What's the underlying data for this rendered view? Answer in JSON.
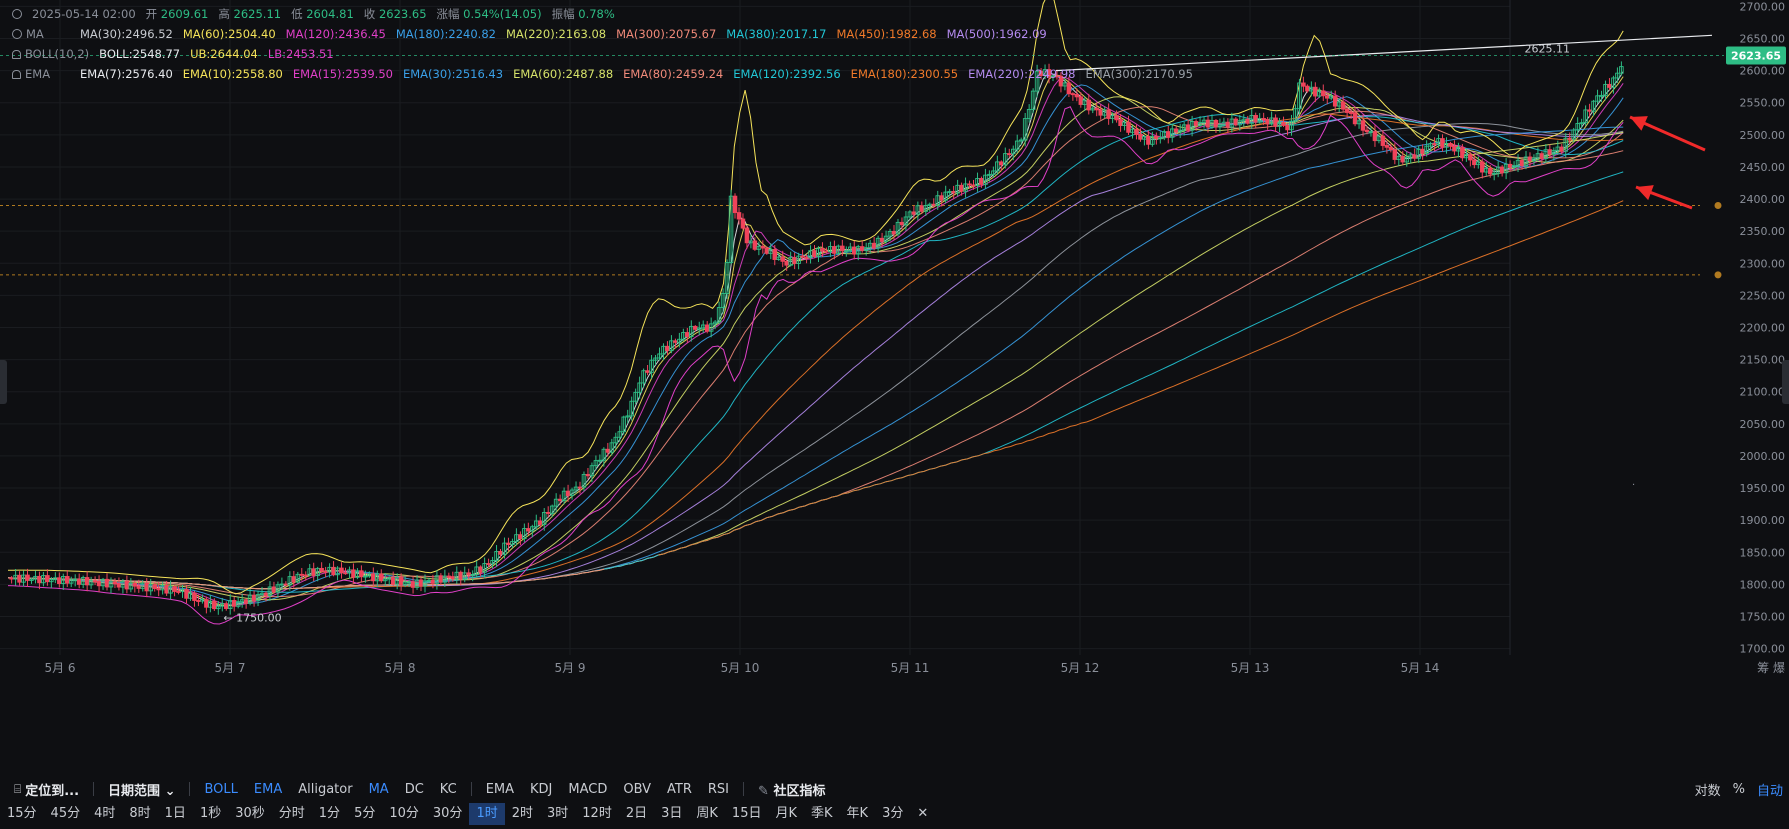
{
  "header": {
    "date": "2025-05-14 02:00",
    "open_label": "开",
    "open": "2609.61",
    "high_label": "高",
    "high": "2625.11",
    "low_label": "低",
    "low": "2604.81",
    "close_label": "收",
    "close": "2623.65",
    "chg_label": "涨幅",
    "chg": "0.54%(14.05)",
    "amp_label": "振幅",
    "amp": "0.78%"
  },
  "ma_row": {
    "tag": "MA",
    "items": [
      {
        "text": "MA(30):2496.52",
        "color": "#c9ccd2"
      },
      {
        "text": "MA(60):2504.40",
        "color": "#f5e35a"
      },
      {
        "text": "MA(120):2436.45",
        "color": "#e040c8"
      },
      {
        "text": "MA(180):2240.82",
        "color": "#3aa0e8"
      },
      {
        "text": "MA(220):2163.08",
        "color": "#d6e26a"
      },
      {
        "text": "MA(300):2075.67",
        "color": "#f08a7a"
      },
      {
        "text": "MA(380):2017.17",
        "color": "#22c7d6"
      },
      {
        "text": "MA(450):1982.68",
        "color": "#f07a2a"
      },
      {
        "text": "MA(500):1962.09",
        "color": "#b58cf0"
      }
    ]
  },
  "boll_row": {
    "tag": "BOLL(10,2)",
    "items": [
      {
        "text": "BOLL:2548.77",
        "color": "#e8eaee"
      },
      {
        "text": "UB:2644.04",
        "color": "#f5e35a"
      },
      {
        "text": "LB:2453.51",
        "color": "#e040c8"
      }
    ]
  },
  "ema_row": {
    "tag": "EMA",
    "items": [
      {
        "text": "EMA(7):2576.40",
        "color": "#e8eaee"
      },
      {
        "text": "EMA(10):2558.80",
        "color": "#f5e35a"
      },
      {
        "text": "EMA(15):2539.50",
        "color": "#e040c8"
      },
      {
        "text": "EMA(30):2516.43",
        "color": "#3aa0e8"
      },
      {
        "text": "EMA(60):2487.88",
        "color": "#d6e26a"
      },
      {
        "text": "EMA(80):2459.24",
        "color": "#f08a7a"
      },
      {
        "text": "EMA(120):2392.56",
        "color": "#22c7d6"
      },
      {
        "text": "EMA(180):2300.55",
        "color": "#f07a2a"
      },
      {
        "text": "EMA(220):2249.98",
        "color": "#b58cf0"
      },
      {
        "text": "EMA(300):2170.95",
        "color": "#9aa0a8"
      }
    ]
  },
  "price_label": "2623.65",
  "high_marker": "2625.11",
  "low_marker": "← 1750.00",
  "axis_corner": "筹 爆",
  "colors": {
    "up": "#2ebd85",
    "down": "#f0435a",
    "price_tag": "#2ebd85",
    "grid": "#1a1c20",
    "dash": "#b07a20"
  },
  "toolbar": {
    "locate": "定位到...",
    "daterange": "日期范围",
    "indicators_main": [
      "BOLL",
      "EMA",
      "Alligator",
      "MA",
      "DC",
      "KC"
    ],
    "indicators_sub": [
      "EMA",
      "KDJ",
      "MACD",
      "OBV",
      "ATR",
      "RSI"
    ],
    "community": "社区指标",
    "right": [
      "对数",
      "%",
      "自动"
    ]
  },
  "timeframes": [
    "15分",
    "45分",
    "4时",
    "8时",
    "1日",
    "1秒",
    "30秒",
    "分时",
    "1分",
    "5分",
    "10分",
    "30分",
    "1时",
    "2时",
    "3时",
    "12时",
    "2日",
    "3日",
    "周K",
    "15日",
    "月K",
    "季K",
    "年K",
    "3分"
  ],
  "active_timeframe": "1时",
  "chart_data": {
    "type": "candlestick",
    "x_labels": [
      "5月 6",
      "5月 7",
      "5月 8",
      "5月 9",
      "5月 10",
      "5月 11",
      "5月 12",
      "5月 13",
      "5月 14"
    ],
    "y_ticks": [
      1700,
      1750,
      1800,
      1850,
      1900,
      1950,
      2000,
      2050,
      2100,
      2150,
      2200,
      2250,
      2300,
      2350,
      2400,
      2450,
      2500,
      2550,
      2600,
      2650,
      2700
    ],
    "ylim": [
      1690,
      2710
    ],
    "last_price": 2623.65,
    "session_high": 2625.11,
    "session_low": 1750.0,
    "horizontal_levels": [
      2390,
      2282
    ],
    "price_path": [
      [
        0,
        1810
      ],
      [
        20,
        1808
      ],
      [
        40,
        1805
      ],
      [
        60,
        1800
      ],
      [
        80,
        1795
      ],
      [
        95,
        1790
      ],
      [
        105,
        1775
      ],
      [
        115,
        1765
      ],
      [
        125,
        1770
      ],
      [
        135,
        1778
      ],
      [
        145,
        1790
      ],
      [
        155,
        1805
      ],
      [
        165,
        1818
      ],
      [
        175,
        1822
      ],
      [
        185,
        1820
      ],
      [
        195,
        1815
      ],
      [
        205,
        1810
      ],
      [
        215,
        1805
      ],
      [
        225,
        1800
      ],
      [
        235,
        1806
      ],
      [
        245,
        1812
      ],
      [
        255,
        1815
      ],
      [
        265,
        1830
      ],
      [
        275,
        1860
      ],
      [
        285,
        1880
      ],
      [
        295,
        1900
      ],
      [
        305,
        1935
      ],
      [
        315,
        1950
      ],
      [
        325,
        1990
      ],
      [
        335,
        2020
      ],
      [
        345,
        2080
      ],
      [
        350,
        2120
      ],
      [
        360,
        2160
      ],
      [
        370,
        2180
      ],
      [
        380,
        2200
      ],
      [
        390,
        2200
      ],
      [
        397,
        2260
      ],
      [
        400,
        2400
      ],
      [
        410,
        2330
      ],
      [
        420,
        2320
      ],
      [
        430,
        2300
      ],
      [
        440,
        2310
      ],
      [
        450,
        2320
      ],
      [
        460,
        2322
      ],
      [
        470,
        2320
      ],
      [
        480,
        2330
      ],
      [
        490,
        2350
      ],
      [
        500,
        2380
      ],
      [
        510,
        2390
      ],
      [
        520,
        2410
      ],
      [
        530,
        2420
      ],
      [
        540,
        2430
      ],
      [
        550,
        2460
      ],
      [
        560,
        2490
      ],
      [
        565,
        2540
      ],
      [
        570,
        2600
      ],
      [
        580,
        2590
      ],
      [
        590,
        2560
      ],
      [
        600,
        2540
      ],
      [
        610,
        2530
      ],
      [
        620,
        2510
      ],
      [
        630,
        2490
      ],
      [
        640,
        2500
      ],
      [
        650,
        2510
      ],
      [
        660,
        2520
      ],
      [
        670,
        2515
      ],
      [
        680,
        2520
      ],
      [
        690,
        2525
      ],
      [
        700,
        2520
      ],
      [
        710,
        2510
      ],
      [
        715,
        2580
      ],
      [
        720,
        2570
      ],
      [
        730,
        2560
      ],
      [
        740,
        2540
      ],
      [
        750,
        2510
      ],
      [
        760,
        2490
      ],
      [
        770,
        2460
      ],
      [
        780,
        2470
      ],
      [
        790,
        2490
      ],
      [
        800,
        2480
      ],
      [
        810,
        2460
      ],
      [
        820,
        2440
      ],
      [
        830,
        2450
      ],
      [
        840,
        2460
      ],
      [
        850,
        2470
      ],
      [
        860,
        2480
      ],
      [
        870,
        2520
      ],
      [
        880,
        2560
      ],
      [
        890,
        2590
      ],
      [
        895,
        2623.65
      ]
    ],
    "indicator_end_values": {
      "EMA(7)": 2576.4,
      "EMA(10)": 2558.8,
      "EMA(15)": 2539.5,
      "EMA(30)": 2516.43,
      "EMA(60)": 2487.88,
      "EMA(80)": 2459.24,
      "EMA(120)": 2392.56,
      "EMA(180)": 2300.55,
      "EMA(220)": 2249.98,
      "EMA(300)": 2170.95,
      "MA(30)": 2496.52,
      "MA(60)": 2504.4,
      "MA(120)": 2436.45,
      "MA(180)": 2240.82,
      "MA(220)": 2163.08,
      "MA(300)": 2075.67,
      "MA(380)": 2017.17,
      "MA(450)": 1982.68,
      "MA(500)": 1962.09,
      "UB": 2644.04,
      "LB": 2453.51
    }
  }
}
